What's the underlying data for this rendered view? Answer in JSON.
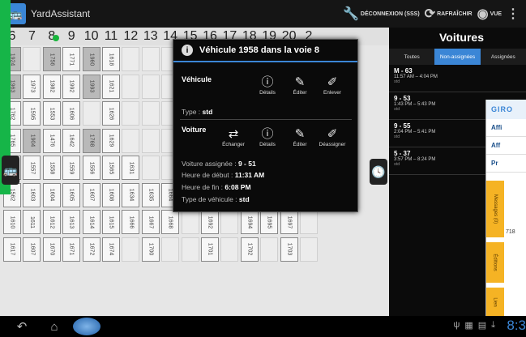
{
  "app": {
    "title": "YardAssistant",
    "icon": "bus-icon"
  },
  "topbar": {
    "logout_label": "DÉCONNEXION (SSS)",
    "refresh_label": "RAFRAÎCHIR",
    "view_label": "VUE"
  },
  "columns": [
    "6",
    "7",
    "8",
    "9",
    "10",
    "11",
    "12",
    "13",
    "14",
    "15",
    "16",
    "17",
    "18",
    "19",
    "20",
    "2"
  ],
  "rows": [
    [
      "1924",
      "",
      "1756",
      "1771",
      "1960",
      "1618",
      "",
      "",
      "",
      "",
      "",
      "",
      "",
      "",
      "1741",
      ""
    ],
    [
      "1963",
      "1973",
      "1982",
      "1992",
      "1993",
      "1621",
      "",
      "",
      "",
      "",
      "",
      "",
      "",
      "",
      "1646",
      ""
    ],
    [
      "1762",
      "1595",
      "1553",
      "1606",
      "",
      "1626",
      "",
      "",
      "",
      "",
      "",
      "",
      "",
      "",
      "1654",
      ""
    ],
    [
      "1765",
      "1904",
      "1476",
      "1642",
      "1768",
      "1629",
      "",
      "",
      "",
      "",
      "",
      "",
      "",
      "",
      "1648",
      ""
    ],
    [
      "1761",
      "1557",
      "1558",
      "1559",
      "1556",
      "1565",
      "1631",
      "",
      "",
      "",
      "",
      "",
      "",
      "",
      "1645",
      ""
    ],
    [
      "1562",
      "1603",
      "1604",
      "1605",
      "1607",
      "1608",
      "1634",
      "1635",
      "1664",
      "",
      "1683",
      "",
      "1684",
      "1685",
      "1686",
      ""
    ],
    [
      "1610",
      "1611",
      "1612",
      "1613",
      "1614",
      "1615",
      "1666",
      "1667",
      "1668",
      "",
      "1692",
      "",
      "1694",
      "1695",
      "1697",
      ""
    ],
    [
      "1617",
      "1607",
      "1670",
      "1671",
      "1672",
      "1674",
      "",
      "1700",
      "",
      "",
      "1701",
      "",
      "1702",
      "",
      "1703",
      ""
    ]
  ],
  "dark_cells": [
    "1924",
    "1963",
    "1960",
    "1993",
    "1904",
    "1768",
    "1756"
  ],
  "dialog": {
    "title": "Véhicule 1958 dans la voie 8",
    "vehicle_label": "Véhicule",
    "vehicle_actions": [
      "Détails",
      "Éditer",
      "Enlever"
    ],
    "type_label": "Type :",
    "type_value": "std",
    "voiture_label": "Voiture",
    "voiture_actions": [
      "Échanger",
      "Détails",
      "Éditer",
      "Déassigner"
    ],
    "assigned_label": "Voiture assignée :",
    "assigned_value": "9 - 51",
    "start_label": "Heure de début :",
    "start_value": "11:31 AM",
    "end_label": "Heure de fin :",
    "end_value": "6:08 PM",
    "vtype_label": "Type de véhicule :",
    "vtype_value": "std"
  },
  "panel": {
    "title": "Voitures",
    "tabs": [
      "Toutes",
      "Non-assignées",
      "Assignées"
    ],
    "active_tab": "Non-assignées",
    "entries": [
      {
        "title": "M - 63",
        "time": "11:57 AM – 4:04 PM",
        "type": "std"
      },
      {
        "title": "9 - 53",
        "time": "1:43 PM – 5:43 PM",
        "type": "std"
      },
      {
        "title": "9 - 55",
        "time": "2:04 PM – 5:41 PM",
        "type": "std"
      },
      {
        "title": "5 - 37",
        "time": "3:57 PM – 8:24 PM",
        "type": "std"
      }
    ]
  },
  "overlay": {
    "logo": "GIRO",
    "row1": "Affi",
    "row2": "Aff",
    "row3": "Pr",
    "side1": "Messages (0)",
    "side2": "Éditions",
    "side3": "Lien",
    "num": "718"
  },
  "statusbar": {
    "time": "8:3"
  },
  "colors": {
    "accent": "#3b86d6",
    "green": "#16b548",
    "orange": "#f5b324"
  }
}
